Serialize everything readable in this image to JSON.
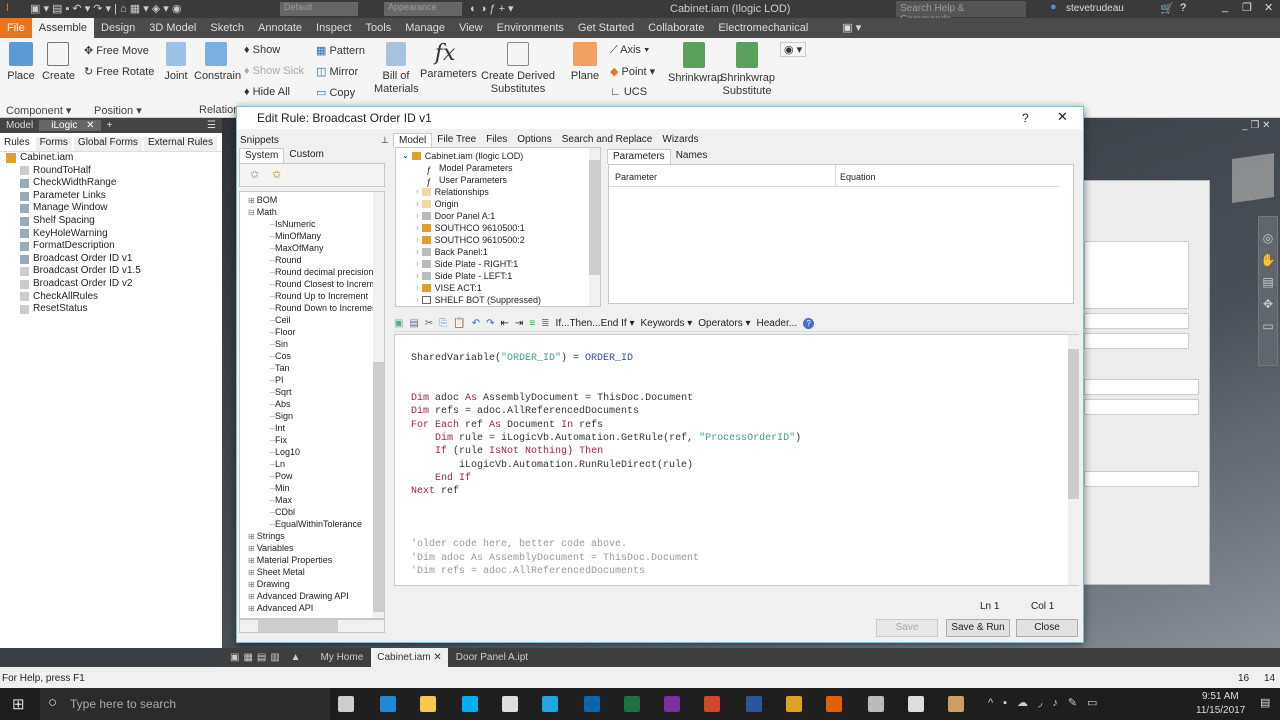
{
  "app": {
    "title": "Cabinet.iam (Ilogic LOD)",
    "search_placeholder": "Search Help & Commands...",
    "user": "stevetrudeau",
    "dd1": "Default",
    "dd2": "Appearance"
  },
  "menu_tabs": [
    "File",
    "Assemble",
    "Design",
    "3D Model",
    "Sketch",
    "Annotate",
    "Inspect",
    "Tools",
    "Manage",
    "View",
    "Environments",
    "Get Started",
    "Collaborate",
    "Electromechanical"
  ],
  "ribbon": {
    "place": "Place",
    "create": "Create",
    "free_move": "Free Move",
    "free_rotate": "Free Rotate",
    "joint": "Joint",
    "constrain": "Constrain",
    "show": "Show",
    "show_sick": "Show Sick",
    "hide_all": "Hide All",
    "pattern": "Pattern",
    "mirror": "Mirror",
    "copy": "Copy",
    "bom": "Bill of Materials",
    "parameters": "Parameters",
    "derived": "Create Derived Substitutes",
    "plane": "Plane",
    "axis": "Axis",
    "point": "Point",
    "ucs": "UCS",
    "shrinkwrap": "Shrinkwrap",
    "shrinkwrap_sub": "Shrinkwrap Substitute",
    "groups": {
      "component": "Component",
      "position": "Position",
      "relationships": "Relation"
    }
  },
  "left_panel": {
    "tabs": [
      "Model",
      "iLogic"
    ],
    "subtabs": [
      "Rules",
      "Forms",
      "Global Forms",
      "External Rules"
    ],
    "root": "Cabinet.iam",
    "rules": [
      {
        "name": "RoundToHalf",
        "enabled": false
      },
      {
        "name": "CheckWidthRange",
        "enabled": true
      },
      {
        "name": "Parameter Links",
        "enabled": true
      },
      {
        "name": "Manage Window",
        "enabled": true
      },
      {
        "name": "Shelf Spacing",
        "enabled": true
      },
      {
        "name": "KeyHoleWarning",
        "enabled": true
      },
      {
        "name": "FormatDescription",
        "enabled": true
      },
      {
        "name": "Broadcast Order ID v1",
        "enabled": true
      },
      {
        "name": "Broadcast Order ID v1.5",
        "enabled": false
      },
      {
        "name": "Broadcast Order ID v2",
        "enabled": false
      },
      {
        "name": "CheckAllRules",
        "enabled": false
      },
      {
        "name": "ResetStatus",
        "enabled": false
      }
    ]
  },
  "dialog": {
    "title": "Edit Rule: Broadcast Order ID v1",
    "help": "?",
    "snippets": {
      "header": "Snippets",
      "tabs": [
        "System",
        "Custom"
      ],
      "tree": [
        {
          "label": "BOM",
          "level": 0
        },
        {
          "label": "Math",
          "level": 0
        },
        {
          "label": "IsNumeric",
          "level": 1
        },
        {
          "label": "MinOfMany",
          "level": 1
        },
        {
          "label": "MaxOfMany",
          "level": 1
        },
        {
          "label": "Round",
          "level": 1
        },
        {
          "label": "Round decimal precision",
          "level": 1
        },
        {
          "label": "Round Closest to Increme",
          "level": 1
        },
        {
          "label": "Round Up to Increment",
          "level": 1
        },
        {
          "label": "Round Down to Incremen",
          "level": 1
        },
        {
          "label": "Ceil",
          "level": 1
        },
        {
          "label": "Floor",
          "level": 1
        },
        {
          "label": "Sin",
          "level": 1
        },
        {
          "label": "Cos",
          "level": 1
        },
        {
          "label": "Tan",
          "level": 1
        },
        {
          "label": "PI",
          "level": 1
        },
        {
          "label": "Sqrt",
          "level": 1
        },
        {
          "label": "Abs",
          "level": 1
        },
        {
          "label": "Sign",
          "level": 1
        },
        {
          "label": "Int",
          "level": 1
        },
        {
          "label": "Fix",
          "level": 1
        },
        {
          "label": "Log10",
          "level": 1
        },
        {
          "label": "Ln",
          "level": 1
        },
        {
          "label": "Pow",
          "level": 1
        },
        {
          "label": "Min",
          "level": 1
        },
        {
          "label": "Max",
          "level": 1
        },
        {
          "label": "CDbl",
          "level": 1
        },
        {
          "label": "EqualWithinTolerance",
          "level": 1
        },
        {
          "label": "Strings",
          "level": 0
        },
        {
          "label": "Variables",
          "level": 0
        },
        {
          "label": "Material Properties",
          "level": 0
        },
        {
          "label": "Sheet Metal",
          "level": 0
        },
        {
          "label": "Drawing",
          "level": 0
        },
        {
          "label": "Advanced Drawing API",
          "level": 0
        },
        {
          "label": "Advanced API",
          "level": 0
        }
      ]
    },
    "model_tabs": [
      "Model",
      "File Tree",
      "Files",
      "Options",
      "Search and Replace",
      "Wizards"
    ],
    "model_tree": [
      {
        "label": "Cabinet.iam (Ilogic LOD)",
        "icon": "assembly"
      },
      {
        "label": "Model Parameters",
        "icon": "fx"
      },
      {
        "label": "User Parameters",
        "icon": "fx"
      },
      {
        "label": "Relationships",
        "icon": "folder"
      },
      {
        "label": "Origin",
        "icon": "folder"
      },
      {
        "label": "Door Panel A:1",
        "icon": "part"
      },
      {
        "label": "SOUTHCO 9610500:1",
        "icon": "assembly"
      },
      {
        "label": "SOUTHCO 9610500:2",
        "icon": "assembly"
      },
      {
        "label": "Back Panel:1",
        "icon": "part"
      },
      {
        "label": "Side Plate - RIGHT:1",
        "icon": "part"
      },
      {
        "label": "Side Plate - LEFT:1",
        "icon": "part"
      },
      {
        "label": "VISE ACT:1",
        "icon": "assembly"
      },
      {
        "label": "SHELF BOT (Suppressed)",
        "icon": "suppressed"
      }
    ],
    "param_tabs": [
      "Parameters",
      "Names"
    ],
    "param_columns": [
      "Parameter",
      "Equation"
    ],
    "toolbar": {
      "if_then": "If...Then...End If",
      "keywords": "Keywords",
      "operators": "Operators",
      "header": "Header..."
    },
    "code": [
      [],
      [
        {
          "t": "SharedVariable(",
          "c": "id"
        },
        {
          "t": "\"ORDER_ID\"",
          "c": "str"
        },
        {
          "t": ") = ",
          "c": "id"
        },
        {
          "t": "ORDER_ID",
          "c": "var"
        }
      ],
      [],
      [],
      [
        {
          "t": "Dim",
          "c": "kw"
        },
        {
          "t": " adoc ",
          "c": "id"
        },
        {
          "t": "As",
          "c": "kw"
        },
        {
          "t": " AssemblyDocument = ThisDoc.Document",
          "c": "id"
        }
      ],
      [
        {
          "t": "Dim",
          "c": "kw"
        },
        {
          "t": " refs = adoc.AllReferencedDocuments",
          "c": "id"
        }
      ],
      [
        {
          "t": "For Each",
          "c": "kw"
        },
        {
          "t": " ref ",
          "c": "id"
        },
        {
          "t": "As",
          "c": "kw"
        },
        {
          "t": " Document ",
          "c": "id"
        },
        {
          "t": "In",
          "c": "kw"
        },
        {
          "t": " refs",
          "c": "id"
        }
      ],
      [
        {
          "t": "    ",
          "c": "id"
        },
        {
          "t": "Dim",
          "c": "kw"
        },
        {
          "t": " rule = iLogicVb.Automation.GetRule(ref, ",
          "c": "id"
        },
        {
          "t": "\"ProcessOrderID\"",
          "c": "str"
        },
        {
          "t": ")",
          "c": "id"
        }
      ],
      [
        {
          "t": "    ",
          "c": "id"
        },
        {
          "t": "If",
          "c": "kw"
        },
        {
          "t": " (rule ",
          "c": "id"
        },
        {
          "t": "IsNot Nothing",
          "c": "kw"
        },
        {
          "t": ") ",
          "c": "id"
        },
        {
          "t": "Then",
          "c": "kw"
        }
      ],
      [
        {
          "t": "        iLogicVb.Automation.RunRuleDirect(rule)",
          "c": "id"
        }
      ],
      [
        {
          "t": "    ",
          "c": "id"
        },
        {
          "t": "End If",
          "c": "kw"
        }
      ],
      [
        {
          "t": "Next",
          "c": "kw"
        },
        {
          "t": " ref",
          "c": "id"
        }
      ],
      [],
      [],
      [],
      [
        {
          "t": "'older code here, better code above.",
          "c": "cm"
        }
      ],
      [
        {
          "t": "'Dim adoc As AssemblyDocument = ThisDoc.Document",
          "c": "cm"
        }
      ],
      [
        {
          "t": "'Dim refs = adoc.AllReferencedDocuments",
          "c": "cm"
        }
      ]
    ],
    "status": {
      "ln": "Ln 1",
      "col": "Col 1"
    },
    "buttons": {
      "save": "Save",
      "save_run": "Save & Run",
      "close": "Close"
    }
  },
  "doc_tabs": [
    "My Home",
    "Cabinet.iam",
    "Door Panel A.ipt"
  ],
  "statusbar": {
    "help": "For Help, press F1",
    "n1": "16",
    "n2": "14"
  },
  "taskbar": {
    "search_placeholder": "Type here to search",
    "time": "9:51 AM",
    "date": "11/15/2017",
    "apps": [
      {
        "name": "task-view",
        "color": "#ccc"
      },
      {
        "name": "edge",
        "color": "#1e8ad6"
      },
      {
        "name": "file-explorer",
        "color": "#f2c94c"
      },
      {
        "name": "skype",
        "color": "#00aff0"
      },
      {
        "name": "store",
        "color": "#ddd"
      },
      {
        "name": "internet-explorer",
        "color": "#1ea7e1"
      },
      {
        "name": "outlook",
        "color": "#0a64ad"
      },
      {
        "name": "excel",
        "color": "#1e7145"
      },
      {
        "name": "onenote",
        "color": "#7b2f9e"
      },
      {
        "name": "powerpoint",
        "color": "#d24726"
      },
      {
        "name": "word",
        "color": "#2b579a"
      },
      {
        "name": "chrome",
        "color": "#e0a020"
      },
      {
        "name": "firefox",
        "color": "#e66000"
      },
      {
        "name": "snipping-tool",
        "color": "#bbb"
      },
      {
        "name": "app-badge",
        "color": "#ddd"
      },
      {
        "name": "inventor",
        "color": "#c8a060"
      }
    ]
  },
  "colors": {
    "accent_file": "#e8741e",
    "dialog_border": "#7ec0c8",
    "keyword": "#a3253a",
    "string": "#3a9e8e"
  }
}
